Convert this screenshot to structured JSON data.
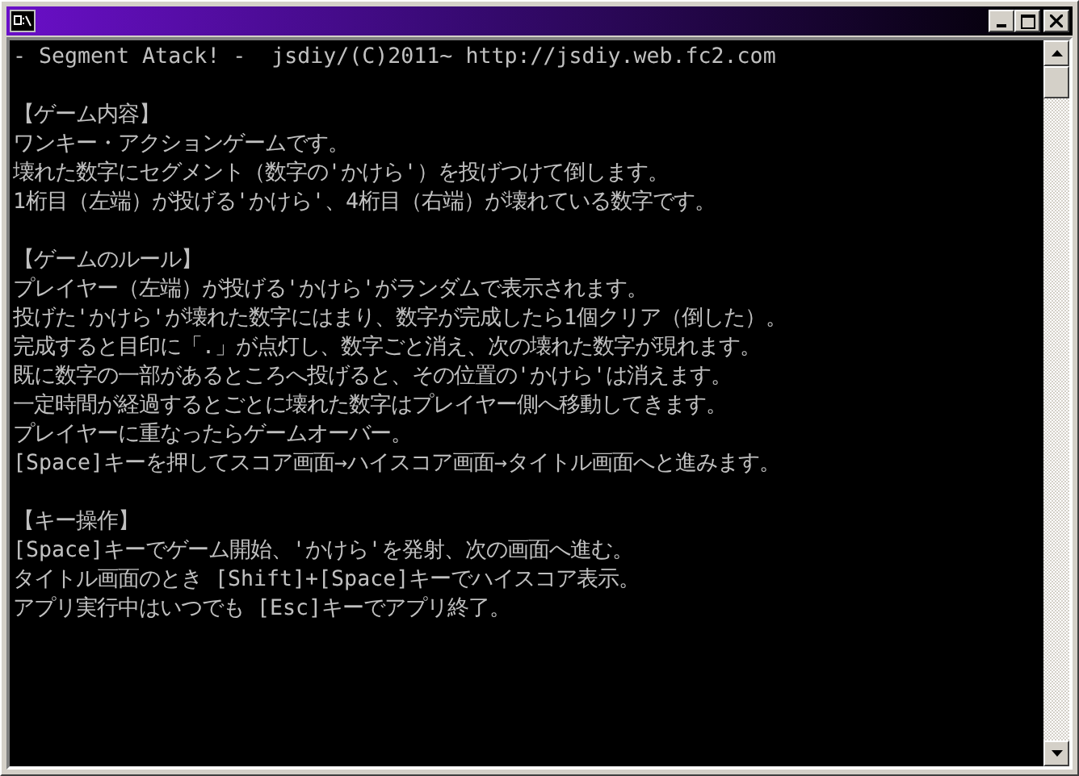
{
  "console": {
    "header": "- Segment Atack! -  jsdiy/(C)2011~ http://jsdiy.web.fc2.com",
    "sections": [
      {
        "heading": "【ゲーム内容】",
        "lines": [
          "ワンキー・アクションゲームです。",
          "壊れた数字にセグメント（数字の'かけら'）を投げつけて倒します。",
          "1桁目（左端）が投げる'かけら'、4桁目（右端）が壊れている数字です。"
        ]
      },
      {
        "heading": "【ゲームのルール】",
        "lines": [
          "プレイヤー（左端）が投げる'かけら'がランダムで表示されます。",
          "投げた'かけら'が壊れた数字にはまり、数字が完成したら1個クリア（倒した）。",
          "完成すると目印に「.」が点灯し、数字ごと消え、次の壊れた数字が現れます。",
          "既に数字の一部があるところへ投げると、その位置の'かけら'は消えます。",
          "一定時間が経過するとごとに壊れた数字はプレイヤー側へ移動してきます。",
          "プレイヤーに重なったらゲームオーバー。",
          "[Space]キーを押してスコア画面→ハイスコア画面→タイトル画面へと進みます。"
        ]
      },
      {
        "heading": "【キー操作】",
        "lines": [
          "[Space]キーでゲーム開始、'かけら'を発射、次の画面へ進む。",
          "タイトル画面のとき [Shift]+[Space]キーでハイスコア表示。",
          "アプリ実行中はいつでも [Esc]キーでアプリ終了。"
        ]
      }
    ]
  }
}
